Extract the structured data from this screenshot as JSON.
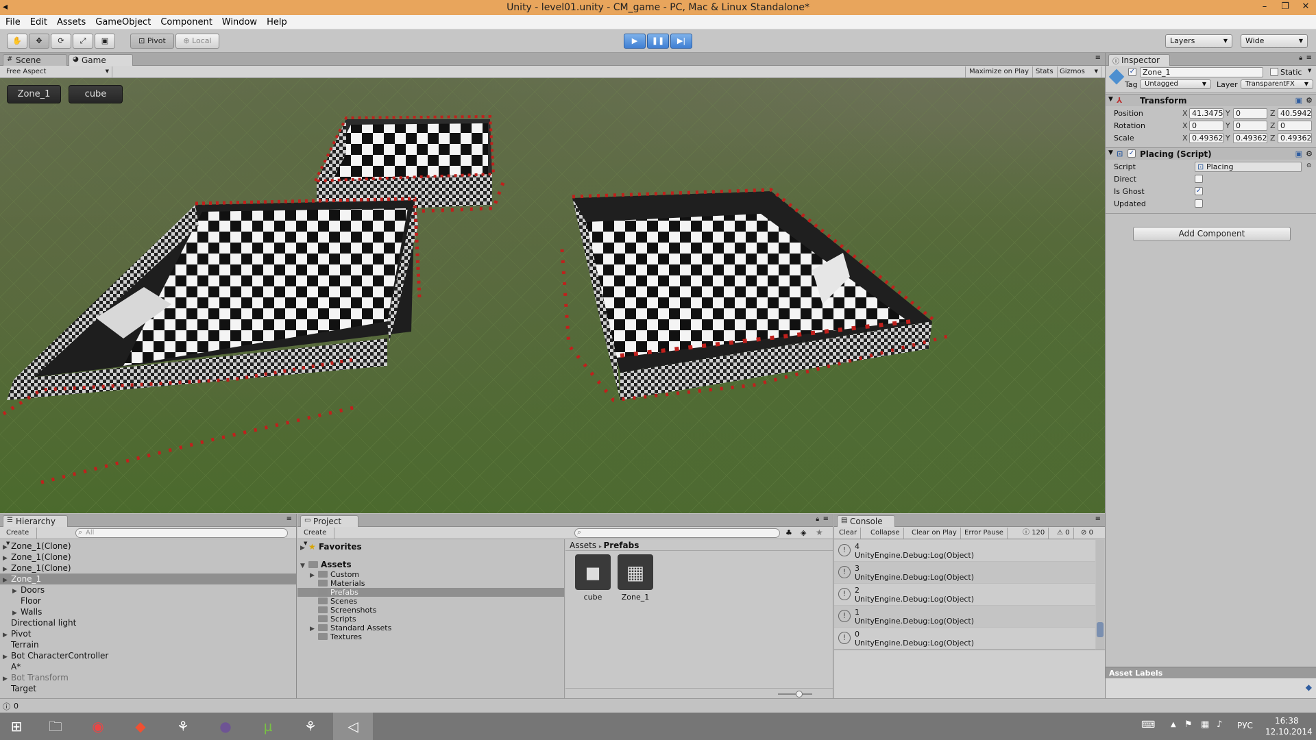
{
  "window": {
    "title": "Unity - level01.unity - CM_game - PC, Mac & Linux Standalone*",
    "controls": [
      "–",
      "❐",
      "✕"
    ]
  },
  "menu": [
    "File",
    "Edit",
    "Assets",
    "GameObject",
    "Component",
    "Window",
    "Help"
  ],
  "toolbar": {
    "tools": [
      "hand-icon",
      "move-icon",
      "rotate-icon",
      "scale-icon",
      "rect-icon"
    ],
    "pivot_label": "Pivot",
    "local_label": "Local",
    "play_icons": [
      "play-icon",
      "pause-icon",
      "step-icon"
    ],
    "layers_label": "Layers",
    "layout_label": "Wide"
  },
  "scene_tabs": {
    "scene": "Scene",
    "game": "Game"
  },
  "game_bar": {
    "aspect": "Free Aspect",
    "maximize": "Maximize on Play",
    "stats": "Stats",
    "gizmos": "Gizmos"
  },
  "game_gui": {
    "zone_button": "Zone_1",
    "cube_button": "cube"
  },
  "inspector": {
    "tab": "Inspector",
    "object_name": "Zone_1",
    "static_label": "Static",
    "tag_label": "Tag",
    "tag_value": "Untagged",
    "layer_label": "Layer",
    "layer_value": "TransparentFX",
    "transform": {
      "title": "Transform",
      "position": {
        "label": "Position",
        "x": "41.3475",
        "y": "0",
        "z": "40.5942"
      },
      "rotation": {
        "label": "Rotation",
        "x": "0",
        "y": "0",
        "z": "0"
      },
      "scale": {
        "label": "Scale",
        "x": "0.49362",
        "y": "0.49362",
        "z": "0.49362"
      }
    },
    "placing": {
      "title": "Placing (Script)",
      "script_label": "Script",
      "script_value": "Placing",
      "direct_label": "Direct",
      "direct": false,
      "ghost_label": "Is Ghost",
      "ghost": true,
      "updated_label": "Updated",
      "updated": false
    },
    "add_component": "Add Component",
    "asset_labels": "Asset Labels"
  },
  "hierarchy": {
    "tab": "Hierarchy",
    "create": "Create",
    "search_placeholder": "All",
    "items": [
      {
        "label": "Zone_1(Clone)",
        "indent": 0,
        "fold": true,
        "state": "normal"
      },
      {
        "label": "Zone_1(Clone)",
        "indent": 0,
        "fold": true,
        "state": "normal"
      },
      {
        "label": "Zone_1(Clone)",
        "indent": 0,
        "fold": true,
        "state": "normal"
      },
      {
        "label": "Zone_1",
        "indent": 0,
        "fold": true,
        "state": "selected"
      },
      {
        "label": "Doors",
        "indent": 1,
        "fold": true,
        "state": "normal"
      },
      {
        "label": "Floor",
        "indent": 1,
        "fold": false,
        "state": "normal"
      },
      {
        "label": "Walls",
        "indent": 1,
        "fold": true,
        "state": "normal"
      },
      {
        "label": "Directional light",
        "indent": 0,
        "fold": false,
        "state": "normal"
      },
      {
        "label": "Pivot",
        "indent": 0,
        "fold": true,
        "state": "normal"
      },
      {
        "label": "Terrain",
        "indent": 0,
        "fold": false,
        "state": "normal"
      },
      {
        "label": "Bot CharacterController",
        "indent": 0,
        "fold": true,
        "state": "normal"
      },
      {
        "label": "A*",
        "indent": 0,
        "fold": false,
        "state": "normal"
      },
      {
        "label": "Bot Transform",
        "indent": 0,
        "fold": true,
        "state": "disabled"
      },
      {
        "label": "Target",
        "indent": 0,
        "fold": false,
        "state": "normal"
      }
    ]
  },
  "project": {
    "tab": "Project",
    "create": "Create",
    "favorites": "Favorites",
    "assets": "Assets",
    "folders": [
      {
        "label": "Custom",
        "fold": true,
        "selected": false
      },
      {
        "label": "Materials",
        "fold": false,
        "selected": false
      },
      {
        "label": "Prefabs",
        "fold": false,
        "selected": true
      },
      {
        "label": "Scenes",
        "fold": false,
        "selected": false
      },
      {
        "label": "Screenshots",
        "fold": false,
        "selected": false
      },
      {
        "label": "Scripts",
        "fold": false,
        "selected": false
      },
      {
        "label": "Standard Assets",
        "fold": true,
        "selected": false
      },
      {
        "label": "Textures",
        "fold": false,
        "selected": false
      }
    ],
    "breadcrumb": {
      "root": "Assets",
      "current": "Prefabs"
    },
    "assets_grid": [
      {
        "label": "cube",
        "icon": "cube-prefab-icon"
      },
      {
        "label": "Zone_1",
        "icon": "zone-prefab-icon"
      }
    ]
  },
  "console": {
    "tab": "Console",
    "buttons": [
      "Clear",
      "Collapse",
      "Clear on Play",
      "Error Pause"
    ],
    "counts": {
      "info": "120",
      "warn": "0",
      "error": "0"
    },
    "entries": [
      {
        "line1": "4",
        "line2": "UnityEngine.Debug:Log(Object)"
      },
      {
        "line1": "3",
        "line2": "UnityEngine.Debug:Log(Object)"
      },
      {
        "line1": "2",
        "line2": "UnityEngine.Debug:Log(Object)"
      },
      {
        "line1": "1",
        "line2": "UnityEngine.Debug:Log(Object)"
      },
      {
        "line1": "0",
        "line2": "UnityEngine.Debug:Log(Object)"
      }
    ]
  },
  "statusbar": {
    "text": "0"
  },
  "taskbar": {
    "apps": [
      "explorer-icon",
      "chrome-icon",
      "git-icon",
      "mono-icon",
      "github-icon",
      "utorrent-icon",
      "mono2-icon",
      "unity-icon"
    ],
    "lang": "РУС",
    "time": "16:38",
    "date": "12.10.2014"
  },
  "colors": {
    "titlebar": "#e8a55c",
    "selection": "#8f8f8f",
    "play_blue": "#3f7fd3",
    "gizmo_red": "#c0201c"
  }
}
